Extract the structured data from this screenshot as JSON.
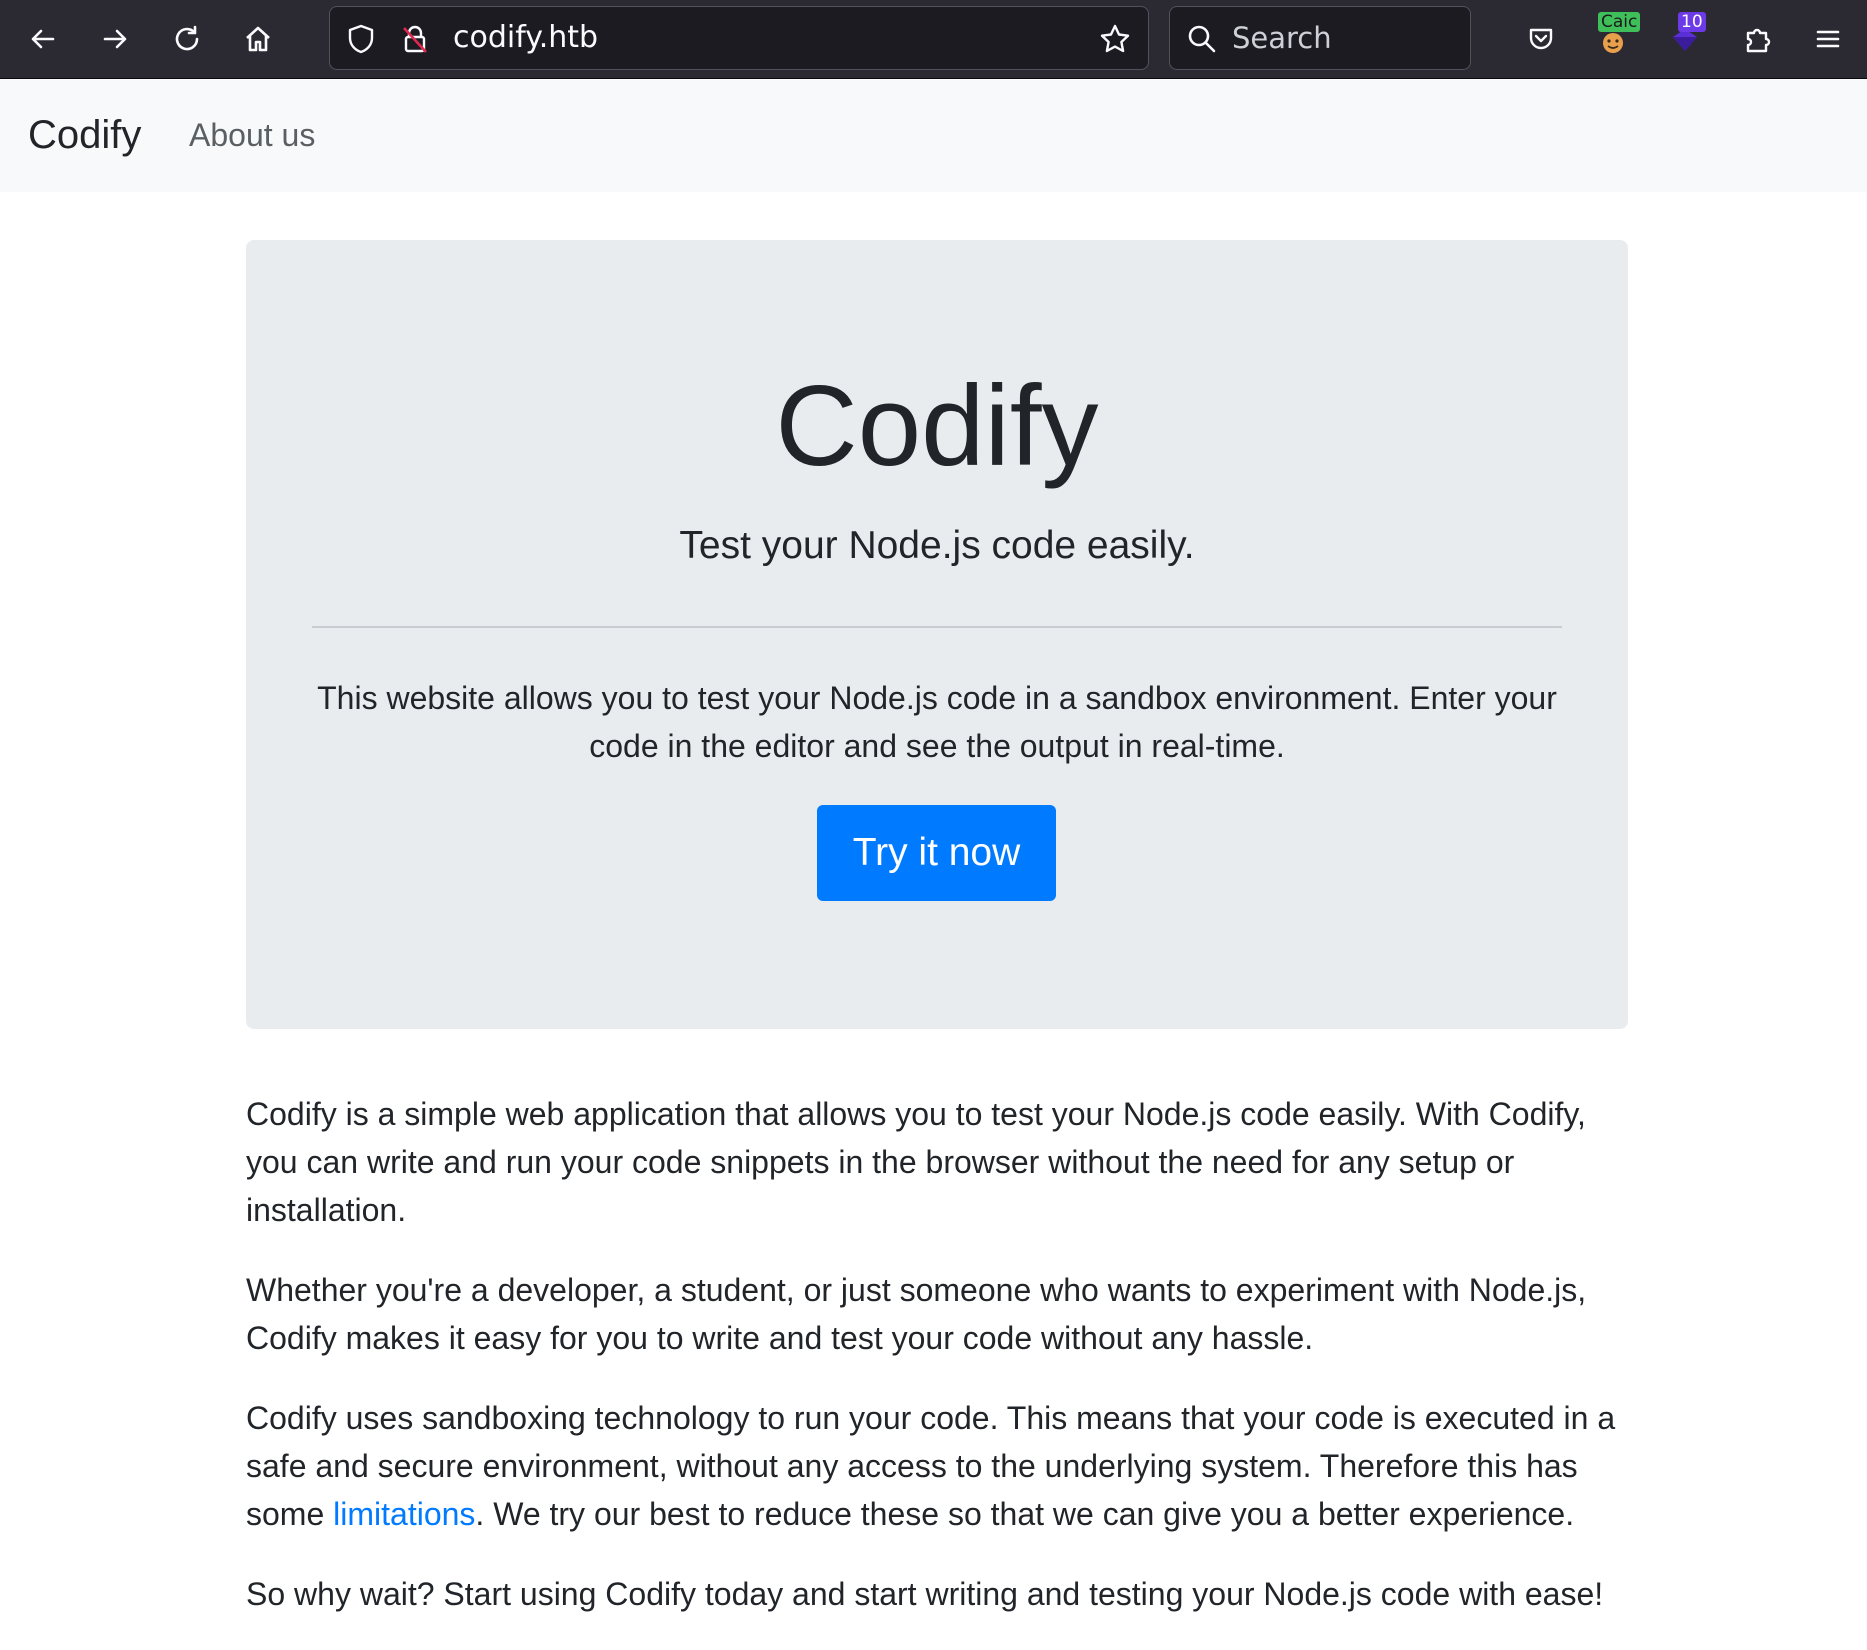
{
  "browser": {
    "url": "codify.htb",
    "search_placeholder": "Search",
    "extension_badges": {
      "ext1": "Caic",
      "ext2": "10"
    }
  },
  "navbar": {
    "brand": "Codify",
    "links": [
      "About us"
    ]
  },
  "hero": {
    "title": "Codify",
    "lead": "Test your Node.js code easily.",
    "body_line1": "This website allows you to test your Node.js code in a sandbox environment. Enter your",
    "body_line2": "code in the editor and see the output in real-time.",
    "cta": "Try it now"
  },
  "content": {
    "p1": "Codify is a simple web application that allows you to test your Node.js code easily. With Codify, you can write and run your code snippets in the browser without the need for any setup or installation.",
    "p2": "Whether you're a developer, a student, or just someone who wants to experiment with Node.js, Codify makes it easy for you to write and test your code without any hassle.",
    "p3_before": "Codify uses sandboxing technology to run your code. This means that your code is executed in a safe and secure environment, without any access to the underlying system. Therefore this has some ",
    "p3_link": "limitations",
    "p3_after": ". We try our best to reduce these so that we can give you a better experience.",
    "p4": "So why wait? Start using Codify today and start writing and testing your Node.js code with ease!"
  },
  "colors": {
    "chrome_bg": "#2b2a33",
    "urlbar_bg": "#1c1b22",
    "navbar_bg": "#f8f9fa",
    "jumbotron_bg": "#e9ecef",
    "primary": "#007bff",
    "text": "#212529"
  }
}
